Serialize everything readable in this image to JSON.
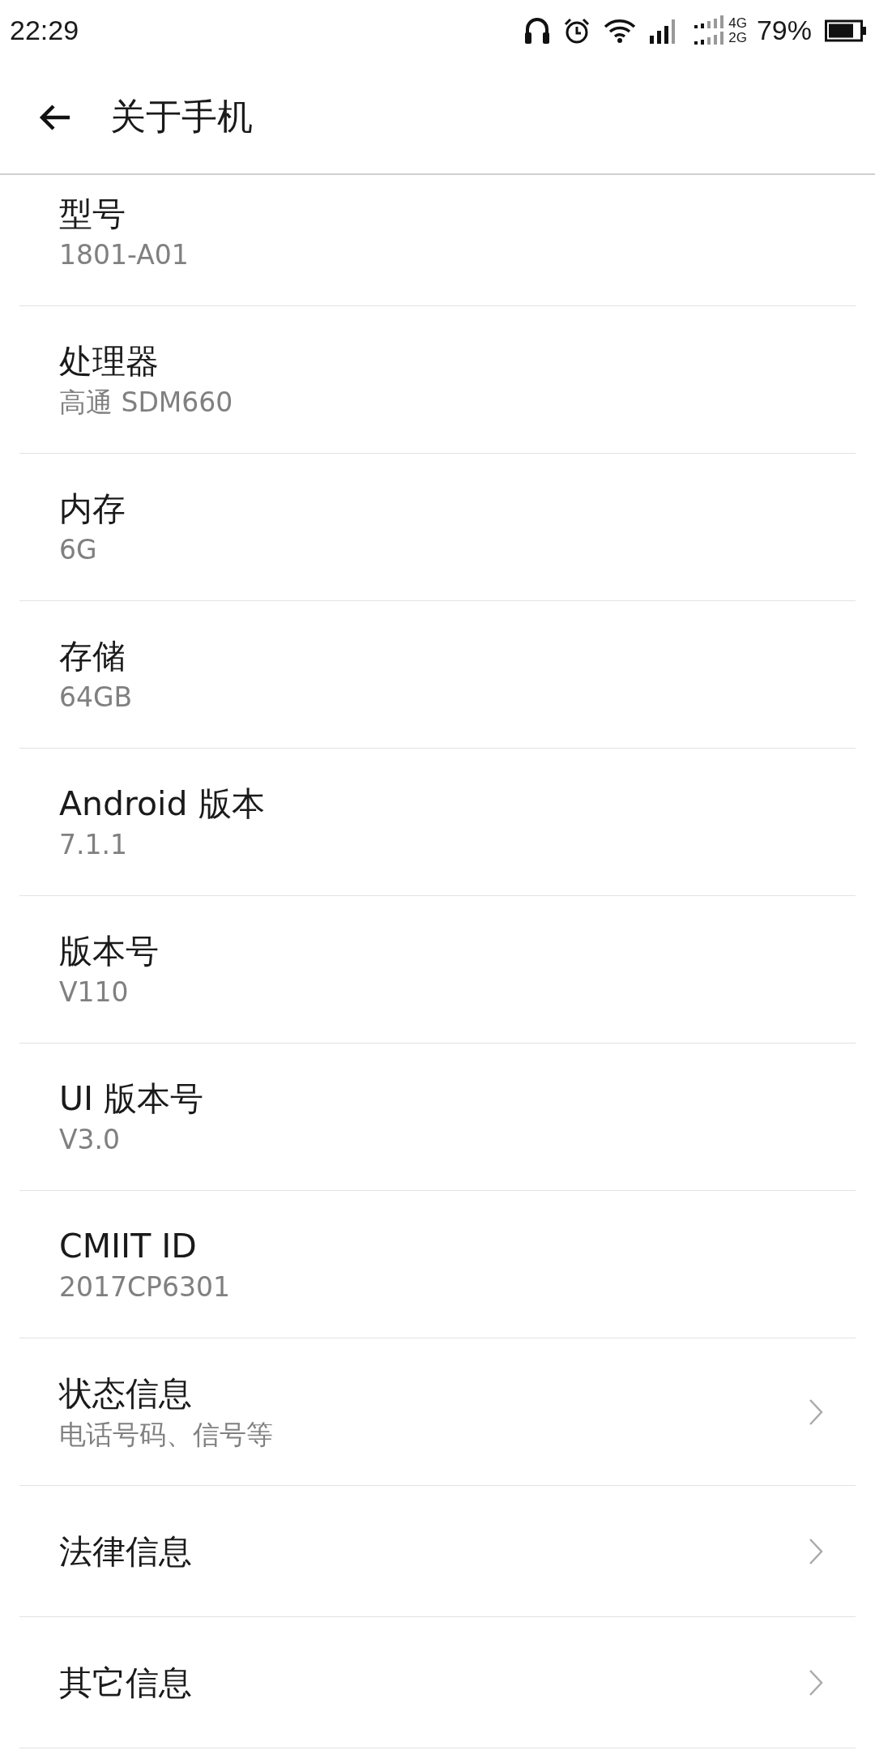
{
  "status_bar": {
    "time": "22:29",
    "net_top": "4G",
    "net_bottom": "2G",
    "battery": "79%"
  },
  "header": {
    "title": "关于手机"
  },
  "items": [
    {
      "kind": "info",
      "title": "型号",
      "subtitle": "1801-A01"
    },
    {
      "kind": "info",
      "title": "处理器",
      "subtitle": "高通 SDM660"
    },
    {
      "kind": "info",
      "title": "内存",
      "subtitle": "6G"
    },
    {
      "kind": "info",
      "title": "存储",
      "subtitle": "64GB"
    },
    {
      "kind": "info",
      "title": "Android 版本",
      "subtitle": "7.1.1"
    },
    {
      "kind": "info",
      "title": "版本号",
      "subtitle": "V110"
    },
    {
      "kind": "info",
      "title": "UI 版本号",
      "subtitle": "V3.0"
    },
    {
      "kind": "info",
      "title": "CMIIT ID",
      "subtitle": "2017CP6301"
    },
    {
      "kind": "link",
      "title": "状态信息",
      "subtitle": "电话号码、信号等"
    },
    {
      "kind": "link",
      "title": "法律信息"
    },
    {
      "kind": "link",
      "title": "其它信息"
    }
  ]
}
